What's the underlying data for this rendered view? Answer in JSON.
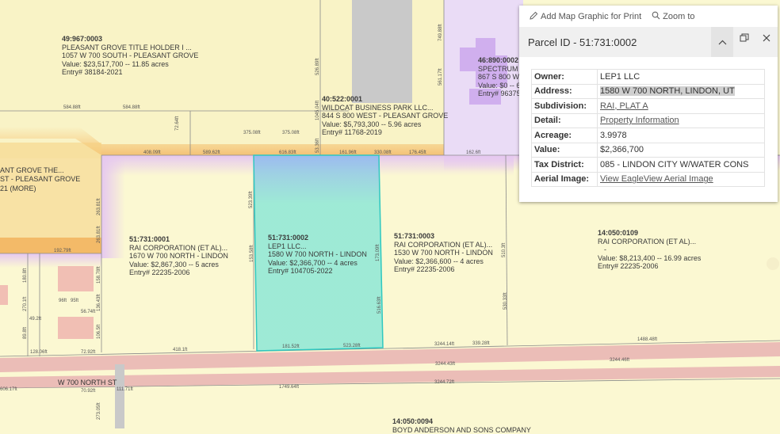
{
  "parcels": [
    {
      "id": "49:967:0003",
      "lines": [
        "PLEASANT GROVE TITLE HOLDER I ...",
        "1057 W 700 SOUTH  - PLEASANT GROVE",
        "Value: $23,517,700 -- 11.85 acres",
        "Entry# 38184-2021"
      ]
    },
    {
      "id": "40:522:0001",
      "lines": [
        "WILDCAT BUSINESS PARK LLC...",
        "844 S 800 WEST  - PLEASANT GROVE",
        "Value: $5,793,300 -- 5.96 acres",
        "Entry# 11768-2019"
      ]
    },
    {
      "id": "46:890:0002",
      "lines": [
        "SPECTRUM A",
        "867 S 800 WE",
        "Value: $0 -- 6.",
        "Entry# 96375-"
      ]
    },
    {
      "id": "",
      "lines": [
        "ANT GROVE THE...",
        "ST  - PLEASANT GROVE",
        "21 (MORE)"
      ]
    },
    {
      "id": "51:731:0001",
      "lines": [
        "RAI CORPORATION (ET AL)...",
        "1670 W 700 NORTH  - LINDON",
        "Value: $2,867,300 -- 5 acres",
        "Entry# 22235-2006"
      ]
    },
    {
      "id": "51:731:0002",
      "lines": [
        "LEP1 LLC...",
        "1580 W 700 NORTH  - LINDON",
        "Value: $2,366,700 -- 4 acres",
        "Entry# 104705-2022"
      ]
    },
    {
      "id": "51:731:0003",
      "lines": [
        "RAI CORPORATION (ET AL)...",
        "1530 W 700 NORTH  - LINDON",
        "Value: $2,366,600 -- 4 acres",
        "Entry# 22235-2006"
      ]
    },
    {
      "id": "14:050:0109",
      "lines": [
        "RAI CORPORATION (ET AL)...",
        "  -",
        "Value: $8,213,400 -- 16.99 acres",
        "Entry# 22235-2006"
      ]
    },
    {
      "id": "14:050:0094",
      "lines": [
        "BOYD ANDERSON AND SONS COMPANY"
      ]
    }
  ],
  "dimensions": {
    "horizontal": [
      "584.88ft",
      "584.88ft",
      "375.08ft",
      "375.08ft",
      "408.09ft",
      "589.62ft",
      "616.83ft",
      "161.96ft",
      "330.08ft",
      "176.45ft",
      "162.6ft",
      "192.79ft",
      "96ft",
      "95ft",
      "56.74ft",
      "49.2ft",
      "128.06ft",
      "72.92ft",
      "418.1ft",
      "181.52ft",
      "523.28ft",
      "3244.14ft",
      "339.28ft",
      "1488.48ft",
      "3244.43ft",
      "3244.46ft",
      "1749.64ft",
      "3244.72ft",
      "606.17ft",
      "70.92ft",
      "111.71ft"
    ],
    "vertical": [
      "749.88ft",
      "526.89ft",
      "561.17ft",
      "72.64ft",
      "1045.04ft",
      "53.36ft",
      "263.81ft",
      "263.81ft",
      "523.39ft",
      "153.58ft",
      "173.09ft",
      "510.3ft",
      "530.33ft",
      "516.63ft",
      "180.8ft",
      "158.78ft",
      "270.1ft",
      "136.43ft",
      "89.8ft",
      "106.5ft",
      "273.05ft"
    ]
  },
  "roads": {
    "road_name": "W 700 NORTH ST"
  },
  "popup": {
    "toolbar": {
      "add_graphic": "Add Map Graphic for Print",
      "zoom_to": "Zoom to"
    },
    "title": "Parcel ID  -  51:731:0002",
    "rows": [
      {
        "key": "Owner:",
        "value": "LEP1 LLC",
        "link": false
      },
      {
        "key": "Address:",
        "value": "1580 W 700 NORTH, LINDON, UT",
        "link": false,
        "highlight": true
      },
      {
        "key": "Subdivision:",
        "value": "RAI, PLAT A",
        "link": true
      },
      {
        "key": "Detail:",
        "value": "Property Information",
        "link": true
      },
      {
        "key": "Acreage:",
        "value": "3.9978",
        "link": false
      },
      {
        "key": "Value:",
        "value": "$2,366,700",
        "link": false
      },
      {
        "key": "Tax District:",
        "value": "085 - LINDON CITY W/WATER CONS",
        "link": false
      },
      {
        "key": "Aerial Image:",
        "value": "View EagleView Aerial Image",
        "link": true
      }
    ]
  },
  "colors": {
    "map_bg": "#fbf8d2",
    "selected_parcel": "#8ee8d6",
    "selected_outline": "#2fc8c0",
    "road": "#e8b3b3",
    "orange_border": "#f4b860",
    "purple_zone": "#e6d2f2",
    "gray_road": "#c9c9c9"
  },
  "icons": [
    "pencil-icon",
    "zoom-icon",
    "chevron-up-icon",
    "restore-window-icon",
    "close-icon"
  ]
}
